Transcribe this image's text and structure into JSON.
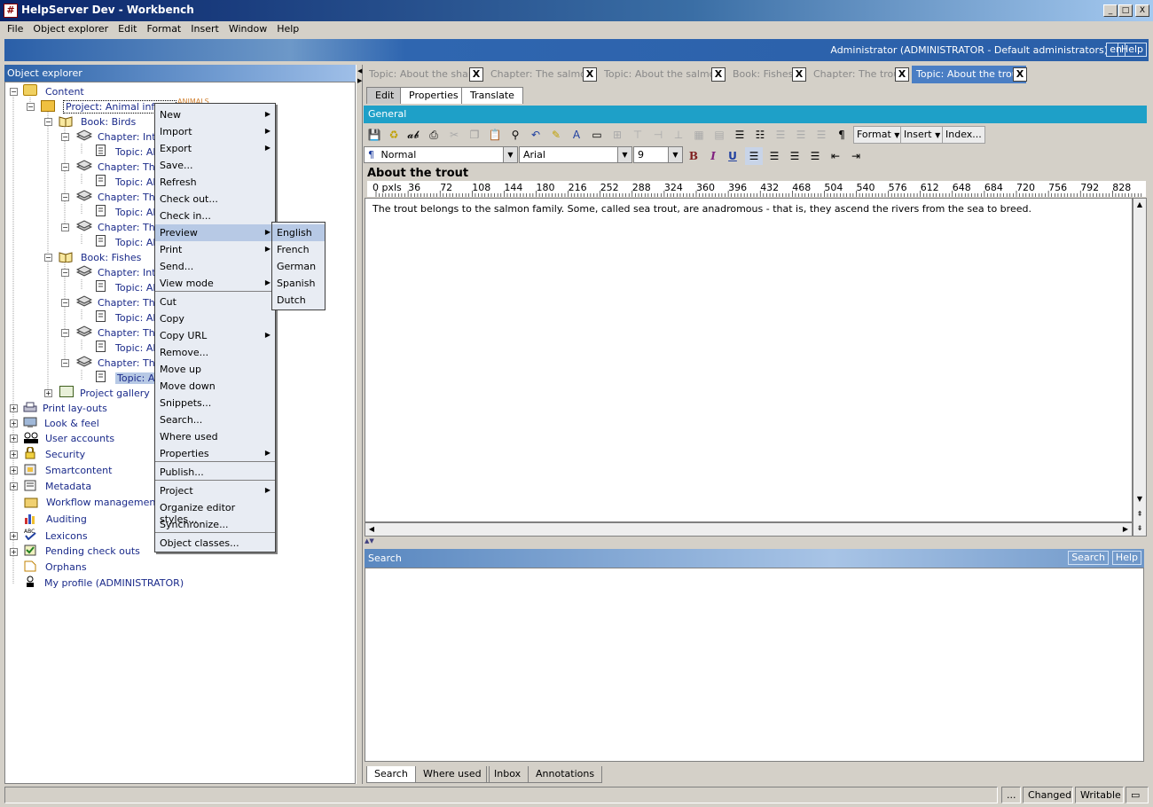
{
  "window": {
    "title": "HelpServer Dev - Workbench",
    "minimize": "_",
    "maximize": "□",
    "close": "X"
  },
  "menubar": [
    "File",
    "Object explorer",
    "Edit",
    "Format",
    "Insert",
    "Window",
    "Help"
  ],
  "banner": {
    "user": "Administrator (ADMINISTRATOR - Default administrators)",
    "lang": "en",
    "help": "Help"
  },
  "object_explorer": {
    "title": "Object explorer",
    "tree": [
      {
        "label": "Content"
      },
      {
        "label": "Project: Animal inform",
        "tag": "ANIMALS"
      },
      {
        "label": "Book: Birds"
      },
      {
        "label": "Chapter: Intro"
      },
      {
        "label": "Topic: Ab"
      },
      {
        "label": "Chapter: The"
      },
      {
        "label": "Topic: Ab"
      },
      {
        "label": "Chapter: The"
      },
      {
        "label": "Topic: Ab"
      },
      {
        "label": "Chapter: The"
      },
      {
        "label": "Topic: Ab"
      },
      {
        "label": "Book: Fishes"
      },
      {
        "label": "Chapter: Intro"
      },
      {
        "label": "Topic: Ab"
      },
      {
        "label": "Chapter: The"
      },
      {
        "label": "Topic: Ab"
      },
      {
        "label": "Chapter: The"
      },
      {
        "label": "Topic: Ab"
      },
      {
        "label": "Chapter: The"
      },
      {
        "label": "Topic: Ab"
      },
      {
        "label": "Project gallery"
      },
      {
        "label": "Print lay-outs"
      },
      {
        "label": "Look & feel"
      },
      {
        "label": "User accounts"
      },
      {
        "label": "Security"
      },
      {
        "label": "Smartcontent"
      },
      {
        "label": "Metadata"
      },
      {
        "label": "Workflow management"
      },
      {
        "label": "Auditing"
      },
      {
        "label": "Lexicons"
      },
      {
        "label": "Pending check outs"
      },
      {
        "label": "Orphans"
      },
      {
        "label": "My profile (ADMINISTRATOR)"
      }
    ]
  },
  "context_menu": {
    "items": [
      {
        "label": "New",
        "sub": true
      },
      {
        "label": "Import",
        "sub": true
      },
      {
        "label": "Export",
        "sub": true
      },
      {
        "label": "Save...",
        "sub": false
      },
      {
        "label": "Refresh",
        "sub": false
      },
      {
        "label": "Check out...",
        "sub": false
      },
      {
        "label": "Check in...",
        "sub": false
      },
      {
        "label": "Preview",
        "sub": true,
        "selected": true
      },
      {
        "label": "Print",
        "sub": true
      },
      {
        "label": "Send...",
        "sub": false
      },
      {
        "label": "View mode",
        "sub": true
      },
      {
        "label": "Cut",
        "sub": false
      },
      {
        "label": "Copy",
        "sub": false
      },
      {
        "label": "Copy URL",
        "sub": true
      },
      {
        "label": "Remove...",
        "sub": false
      },
      {
        "label": "Move up",
        "sub": false
      },
      {
        "label": "Move down",
        "sub": false
      },
      {
        "label": "Snippets...",
        "sub": false
      },
      {
        "label": "Search...",
        "sub": false
      },
      {
        "label": "Where used",
        "sub": false
      },
      {
        "label": "Properties",
        "sub": true
      },
      {
        "label": "Publish...",
        "sub": false
      },
      {
        "label": "Project",
        "sub": true
      },
      {
        "label": "Organize editor styles...",
        "sub": false
      },
      {
        "label": "Synchronize...",
        "sub": false
      },
      {
        "label": "Object classes...",
        "sub": false
      }
    ],
    "submenu": [
      "English",
      "French",
      "German",
      "Spanish",
      "Dutch"
    ]
  },
  "doc_tabs": [
    {
      "label": "Topic: About the shark",
      "active": false
    },
    {
      "label": "Chapter: The salmon",
      "active": false
    },
    {
      "label": "Topic: About the salmon",
      "active": false
    },
    {
      "label": "Book: Fishes",
      "active": false
    },
    {
      "label": "Chapter: The trout",
      "active": false
    },
    {
      "label": "Topic: About the trout",
      "active": true
    }
  ],
  "close_glyph": "X",
  "sub_tabs": [
    "Edit",
    "Properties",
    "Translate"
  ],
  "section": "General",
  "toolbar": {
    "icons": [
      "save-icon",
      "refresh-icon",
      "spellcheck-icon",
      "print-icon",
      "cut-icon",
      "copy-icon",
      "paste-icon",
      "find-icon",
      "undo-icon",
      "highlight-icon",
      "style-icon",
      "frame-icon",
      "table-col-icon",
      "table-row-icon",
      "table-merge-icon",
      "table-split-icon",
      "table-icon",
      "table-cell-icon",
      "numbered-list-icon",
      "bullet-list-icon",
      "list-indent-icon",
      "list-outdent-icon",
      "list-icon",
      "pilcrow-icon"
    ],
    "format": "Format",
    "insert": "Insert",
    "index": "Index..."
  },
  "format_bar": {
    "paragraph_mark": "¶",
    "style": "Normal",
    "font": "Arial",
    "size": "9",
    "bold": "B",
    "italic": "I",
    "underline": "U"
  },
  "document": {
    "title": "About the trout",
    "ruler": [
      "0 pxls",
      "36",
      "72",
      "108",
      "144",
      "180",
      "216",
      "252",
      "288",
      "324",
      "360",
      "396",
      "432",
      "468",
      "504",
      "540",
      "576",
      "612",
      "648",
      "684",
      "720",
      "756",
      "792",
      "828"
    ],
    "body": "The trout belongs to the salmon family. Some, called sea trout, are anadromous - that is, they ascend the rivers from the sea to breed."
  },
  "search_panel": {
    "title": "Search",
    "search_btn": "Search",
    "help_btn": "Help"
  },
  "bottom_tabs": [
    "Search",
    "Where used",
    "Inbox",
    "Annotations"
  ],
  "status": {
    "ellipsis": "...",
    "changed": "Changed",
    "writable": "Writable"
  }
}
